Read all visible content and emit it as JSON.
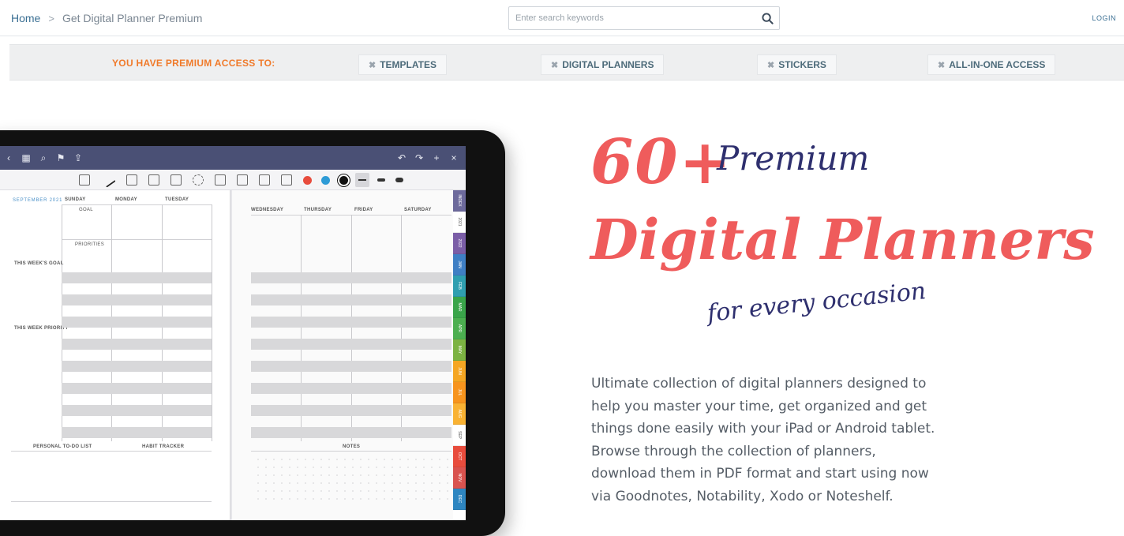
{
  "breadcrumb": {
    "home": "Home",
    "separator": ">",
    "current": "Get Digital Planner Premium"
  },
  "search": {
    "placeholder": "Enter search keywords",
    "icon": "search-icon"
  },
  "header": {
    "login": "LOGIN"
  },
  "access": {
    "title": "YOU HAVE PREMIUM ACCESS TO:",
    "chips": [
      {
        "icon": "close-icon",
        "x": "✖",
        "label": "TEMPLATES"
      },
      {
        "icon": "close-icon",
        "x": "✖",
        "label": "DIGITAL PLANNERS"
      },
      {
        "icon": "close-icon",
        "x": "✖",
        "label": "STICKERS"
      },
      {
        "icon": "close-icon",
        "x": "✖",
        "label": "ALL-IN-ONE ACCESS"
      }
    ]
  },
  "planner": {
    "month_label": "SEPTEMBER 2021",
    "left_days": [
      "SUNDAY",
      "MONDAY",
      "TUESDAY"
    ],
    "right_days": [
      "WEDNESDAY",
      "THURSDAY",
      "FRIDAY",
      "SATURDAY"
    ],
    "sections": {
      "goal": "GOAL",
      "priorities": "PRIORITIES",
      "this_week_goal": "THIS WEEK'S GOAL",
      "this_week_priority": "THIS WEEK PRIORITY",
      "todo": "PERSONAL TO-DO LIST",
      "habit": "HABIT TRACKER",
      "notes": "NOTES"
    },
    "tabs": [
      "INDEX",
      "2021",
      "2022",
      "JAN",
      "FEB",
      "MAR",
      "APR",
      "MAY",
      "JUN",
      "JUL",
      "AUG",
      "SEP",
      "OCT",
      "NOV",
      "DEC"
    ],
    "tab_colors": [
      "#6d6a9c",
      "#ffffff",
      "#7b5ea7",
      "#3f7fc4",
      "#2f9fb0",
      "#3aa54a",
      "#4caf50",
      "#7cb342",
      "#f5a623",
      "#f7941d",
      "#f9b233",
      "#ffffff",
      "#e84c3d",
      "#d9534f",
      "#2e86c1"
    ],
    "ink_colors": [
      "#e84c3d",
      "#2e9bd6",
      "#111111"
    ]
  },
  "hero": {
    "number": "60+",
    "premium": "Premium",
    "title": "Digital Planners",
    "tagline": "for every occasion",
    "description": "Ultimate collection of digital planners designed to help you master your time, get organized and get things done easily with your iPad or Android tablet. Browse through the collection of planners, download them in PDF format and start using now via Goodnotes, Notability, Xodo or Noteshelf."
  }
}
